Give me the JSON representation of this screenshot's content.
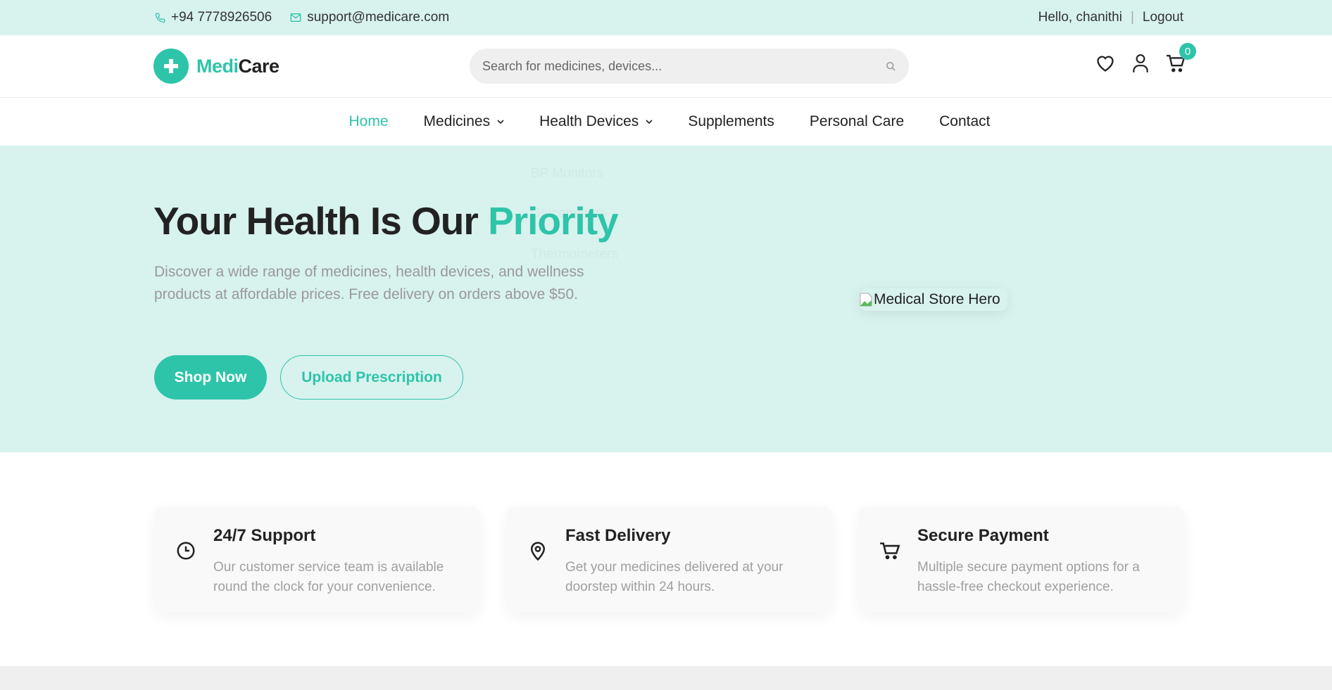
{
  "topbar": {
    "phone": "+94 7778926506",
    "email": "support@medicare.com",
    "greeting": "Hello, chanithi",
    "separator": "|",
    "logout": "Logout"
  },
  "header": {
    "logo_part1": "Medi",
    "logo_part2": "Care",
    "search_placeholder": "Search for medicines, devices...",
    "cart_count": "0"
  },
  "nav": {
    "items": [
      {
        "label": "Home",
        "active": true
      },
      {
        "label": "Medicines",
        "dropdown": true
      },
      {
        "label": "Health Devices",
        "dropdown": true
      },
      {
        "label": "Supplements"
      },
      {
        "label": "Personal Care"
      },
      {
        "label": "Contact"
      }
    ],
    "hidden_dropdown": [
      "BP Monitors",
      "Glucometers",
      "Thermometers"
    ]
  },
  "hero": {
    "title_main": "Your Health Is Our ",
    "title_highlight": "Priority",
    "description": "Discover a wide range of medicines, health devices, and wellness products at affordable prices. Free delivery on orders above $50.",
    "primary_button": "Shop Now",
    "secondary_button": "Upload Prescription",
    "image_alt": "Medical Store Hero"
  },
  "features": [
    {
      "icon": "clock-icon",
      "title": "24/7 Support",
      "description": "Our customer service team is available round the clock for your convenience."
    },
    {
      "icon": "location-pin-icon",
      "title": "Fast Delivery",
      "description": "Get your medicines delivered at your doorstep within 24 hours."
    },
    {
      "icon": "cart-icon",
      "title": "Secure Payment",
      "description": "Multiple secure payment options for a hassle-free checkout experience."
    }
  ],
  "colors": {
    "accent": "#2ec4a9",
    "hero_bg": "#d8f2ee",
    "text": "#222222",
    "muted": "#999999"
  }
}
